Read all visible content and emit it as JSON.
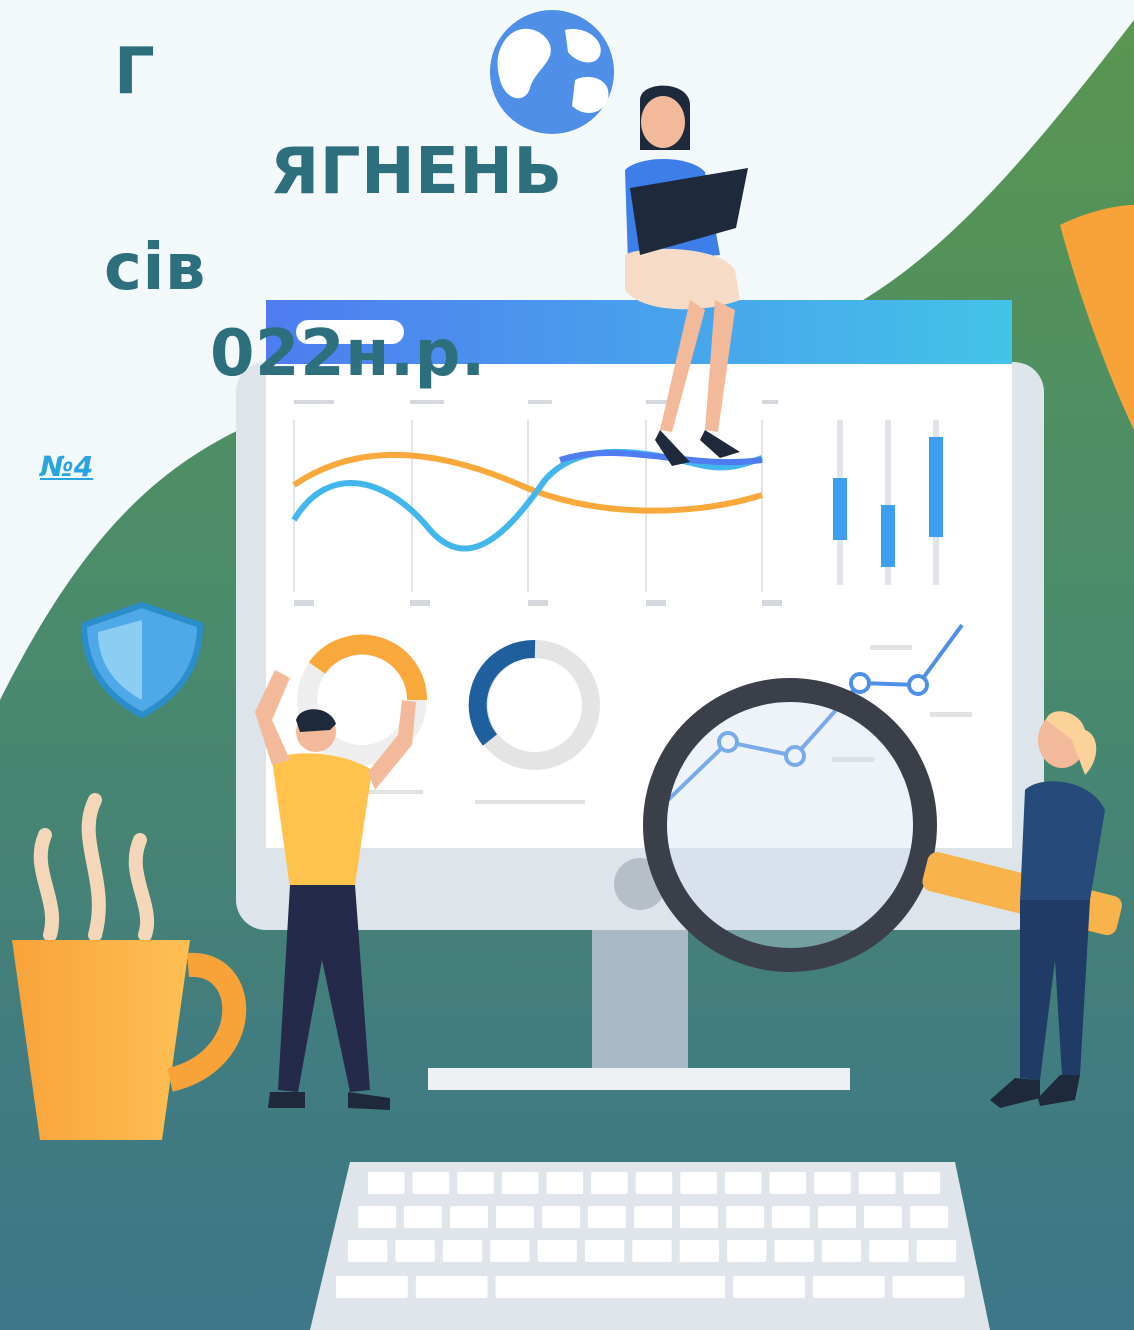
{
  "slide": {
    "title_lines": [
      "Г",
      "ЯГНЕНЬ",
      "сів",
      "022н.р."
    ],
    "link_text": "№4"
  },
  "colors": {
    "title": "#2e6f7d",
    "link": "#2aa4e0",
    "green_wave": "#4f8f55",
    "teal_wave": "#3e7f84",
    "accent_blue": "#4f8fe8",
    "accent_orange": "#f7a33a"
  },
  "icons": [
    "globe-icon",
    "shield-icon",
    "coffee-cup-icon",
    "magnifier-icon",
    "monitor-icon",
    "keyboard-icon"
  ]
}
